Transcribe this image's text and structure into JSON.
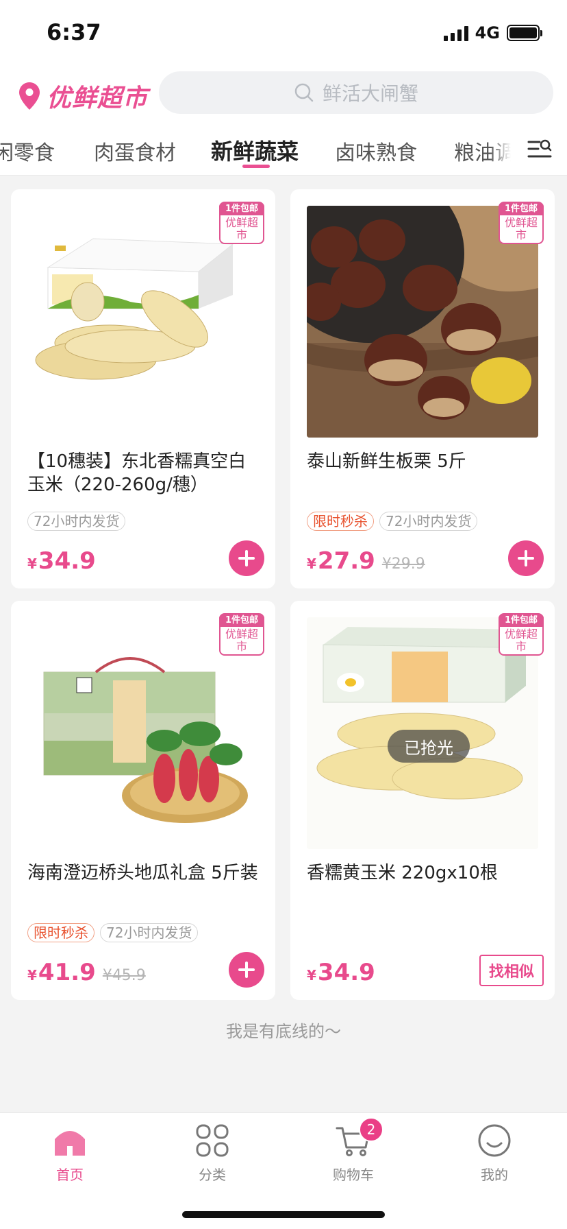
{
  "status": {
    "time": "6:37",
    "network": "4G"
  },
  "header": {
    "brand": "优鲜超市",
    "search_placeholder": "鲜活大闸蟹"
  },
  "tabs": [
    {
      "label": "闲零食"
    },
    {
      "label": "肉蛋食材"
    },
    {
      "label": "新鲜蔬菜"
    },
    {
      "label": "卤味熟食"
    },
    {
      "label": "粮油调"
    }
  ],
  "badge": {
    "top": "1件包邮",
    "bottom": "优鲜超市"
  },
  "products": [
    {
      "title": "【10穗装】东北香糯真空白玉米（220-260g/穗）",
      "tags": [
        "72小时内发货"
      ],
      "currency": "¥",
      "price": "34.9",
      "original_price": "",
      "action": "add"
    },
    {
      "title": "泰山新鲜生板栗 5斤",
      "tags": [
        "限时秒杀",
        "72小时内发货"
      ],
      "currency": "¥",
      "price": "27.9",
      "original_price": "¥29.9",
      "action": "add"
    },
    {
      "title": "海南澄迈桥头地瓜礼盒 5斤装",
      "tags": [
        "限时秒杀",
        "72小时内发货"
      ],
      "currency": "¥",
      "price": "41.9",
      "original_price": "¥45.9",
      "action": "add"
    },
    {
      "title": "香糯黄玉米 220gx10根",
      "tags": [],
      "currency": "¥",
      "price": "34.9",
      "original_price": "",
      "action": "similar",
      "similar_label": "找相似",
      "soldout_label": "已抢光"
    }
  ],
  "footer_hint": "我是有底线的～",
  "nav": [
    {
      "label": "首页",
      "icon": "home-icon"
    },
    {
      "label": "分类",
      "icon": "grid-icon"
    },
    {
      "label": "购物车",
      "icon": "cart-icon",
      "badge": "2"
    },
    {
      "label": "我的",
      "icon": "profile-icon"
    }
  ],
  "colors": {
    "accent": "#e84a8c",
    "flash_sale": "#e8502c"
  }
}
